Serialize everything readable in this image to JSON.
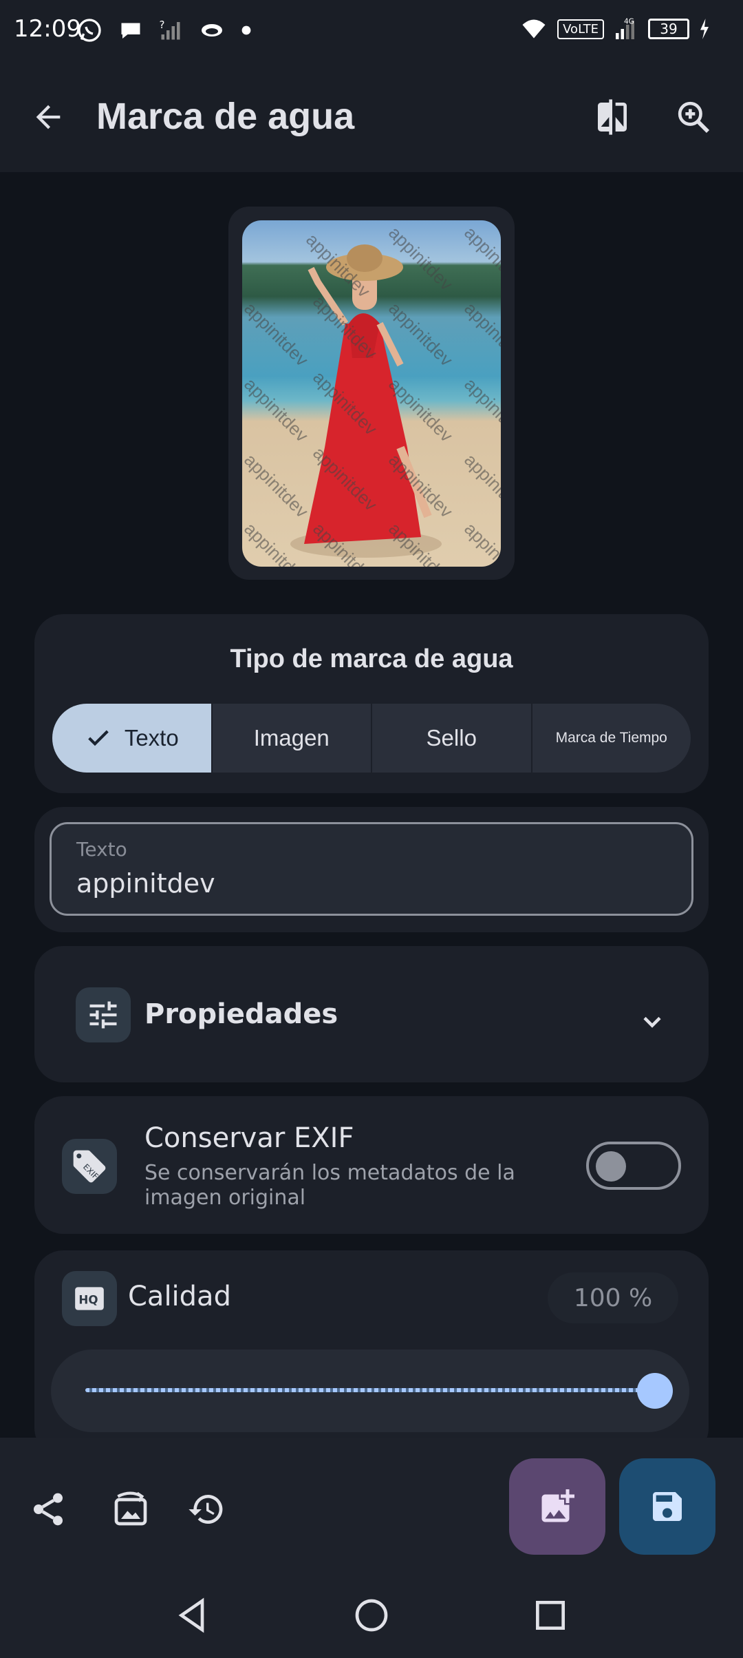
{
  "status_bar": {
    "time": "12:09",
    "battery": "39",
    "network": "4G",
    "volte": "VoLTE"
  },
  "app_bar": {
    "title": "Marca de agua"
  },
  "preview": {
    "watermark_text": "appinitdev"
  },
  "watermark_type": {
    "title": "Tipo de marca de agua",
    "options": [
      "Texto",
      "Imagen",
      "Sello",
      "Marca de Tiempo"
    ],
    "selected_index": 0
  },
  "text_field": {
    "label": "Texto",
    "value": "appinitdev"
  },
  "properties": {
    "label": "Propiedades"
  },
  "exif": {
    "title": "Conservar EXIF",
    "subtitle": "Se conservarán los metadatos de la imagen original",
    "enabled": false
  },
  "quality": {
    "label": "Calidad",
    "value_text": "100 %",
    "value": 1.0
  },
  "icons": {
    "back": "arrow-back-icon",
    "compare": "compare-icon",
    "zoom": "zoom-in-icon",
    "share": "share-icon",
    "image_replace": "image-reset-icon",
    "history": "history-icon",
    "add_image": "add-photo-icon",
    "save": "save-icon",
    "nav_back": "nav-back-icon",
    "nav_home": "nav-home-icon",
    "nav_recents": "nav-recents-icon"
  },
  "colors": {
    "accent": "#a6c8ff",
    "selected_segment": "#bccee3",
    "add_fab": "#5b4770",
    "save_fab": "#1d4d72"
  }
}
